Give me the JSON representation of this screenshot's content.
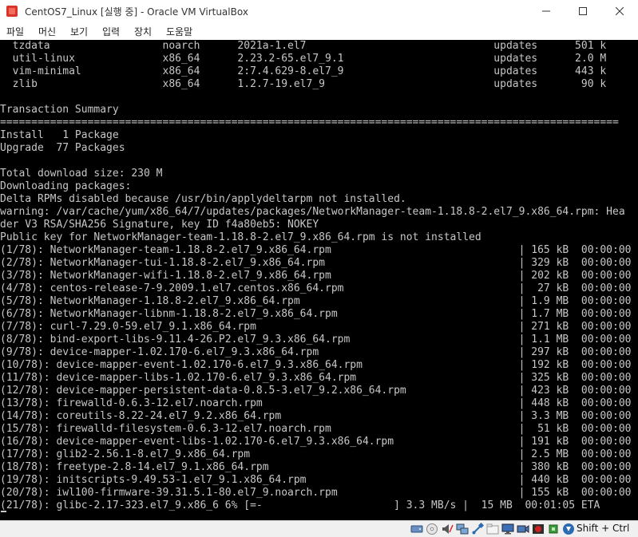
{
  "window": {
    "title": "CentOS7_Linux [실행 중] - Oracle VM VirtualBox"
  },
  "menu": [
    "파일",
    "머신",
    "보기",
    "입력",
    "장치",
    "도움말"
  ],
  "console": {
    "lines": [
      "  tzdata                  noarch      2021a-1.el7                              updates      501 k",
      "  util-linux              x86_64      2.23.2-65.el7_9.1                        updates      2.0 M",
      "  vim-minimal             x86_64      2:7.4.629-8.el7_9                        updates      443 k",
      "  zlib                    x86_64      1.2.7-19.el7_9                           updates       90 k",
      "",
      "Transaction Summary",
      "===================================================================================================",
      "Install   1 Package",
      "Upgrade  77 Packages",
      "",
      "Total download size: 230 M",
      "Downloading packages:",
      "Delta RPMs disabled because /usr/bin/applydeltarpm not installed.",
      "warning: /var/cache/yum/x86_64/7/updates/packages/NetworkManager-team-1.18.8-2.el7_9.x86_64.rpm: Hea",
      "der V3 RSA/SHA256 Signature, key ID f4a80eb5: NOKEY",
      "Public key for NetworkManager-team-1.18.8-2.el7_9.x86_64.rpm is not installed",
      "(1/78): NetworkManager-team-1.18.8-2.el7_9.x86_64.rpm                              | 165 kB  00:00:00",
      "(2/78): NetworkManager-tui-1.18.8-2.el7_9.x86_64.rpm                               | 329 kB  00:00:00",
      "(3/78): NetworkManager-wifi-1.18.8-2.el7_9.x86_64.rpm                              | 202 kB  00:00:00",
      "(4/78): centos-release-7-9.2009.1.el7.centos.x86_64.rpm                            |  27 kB  00:00:00",
      "(5/78): NetworkManager-1.18.8-2.el7_9.x86_64.rpm                                   | 1.9 MB  00:00:00",
      "(6/78): NetworkManager-libnm-1.18.8-2.el7_9.x86_64.rpm                             | 1.7 MB  00:00:00",
      "(7/78): curl-7.29.0-59.el7_9.1.x86_64.rpm                                          | 271 kB  00:00:00",
      "(8/78): bind-export-libs-9.11.4-26.P2.el7_9.3.x86_64.rpm                           | 1.1 MB  00:00:00",
      "(9/78): device-mapper-1.02.170-6.el7_9.3.x86_64.rpm                                | 297 kB  00:00:00",
      "(10/78): device-mapper-event-1.02.170-6.el7_9.3.x86_64.rpm                         | 192 kB  00:00:00",
      "(11/78): device-mapper-libs-1.02.170-6.el7_9.3.x86_64.rpm                          | 325 kB  00:00:00",
      "(12/78): device-mapper-persistent-data-0.8.5-3.el7_9.2.x86_64.rpm                  | 423 kB  00:00:00",
      "(13/78): firewalld-0.6.3-12.el7.noarch.rpm                                         | 448 kB  00:00:00",
      "(14/78): coreutils-8.22-24.el7_9.2.x86_64.rpm                                      | 3.3 MB  00:00:00",
      "(15/78): firewalld-filesystem-0.6.3-12.el7.noarch.rpm                              |  51 kB  00:00:00",
      "(16/78): device-mapper-event-libs-1.02.170-6.el7_9.3.x86_64.rpm                    | 191 kB  00:00:00",
      "(17/78): glib2-2.56.1-8.el7_9.x86_64.rpm                                           | 2.5 MB  00:00:00",
      "(18/78): freetype-2.8-14.el7_9.1.x86_64.rpm                                        | 380 kB  00:00:00",
      "(19/78): initscripts-9.49.53-1.el7_9.1.x86_64.rpm                                  | 440 kB  00:00:00",
      "(20/78): iwl100-firmware-39.31.5.1-80.el7_9.noarch.rpm                             | 155 kB  00:00:00",
      "(21/78): glibc-2.17-323.el7_9.x86_6 6% [=-                     ] 3.3 MB/s |  15 MB  00:01:05 ETA"
    ]
  },
  "statusbar": {
    "icons": [
      "hard-disk-icon",
      "optical-disk-icon",
      "audio-icon",
      "network-icon",
      "usb-icon",
      "shared-folders-icon",
      "display-icon",
      "video-capture-icon",
      "recording-icon",
      "cpu-icon",
      "mouse-integration-icon",
      "host-key-icon"
    ],
    "host_key": "Shift + Ctrl"
  }
}
